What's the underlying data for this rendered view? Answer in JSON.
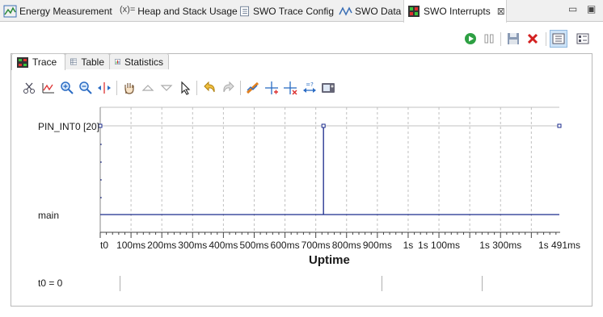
{
  "view_tabs": [
    {
      "label": "Energy Measurement",
      "icon": "energy-icon"
    },
    {
      "label": "Heap and Stack Usage",
      "icon": "heap-stack-icon"
    },
    {
      "label": "SWO Trace Config",
      "icon": "trace-config-icon"
    },
    {
      "label": "SWO Data",
      "icon": "swo-data-icon"
    },
    {
      "label": "SWO Interrupts",
      "icon": "swo-interrupts-icon",
      "active": true
    }
  ],
  "inner_tabs": [
    {
      "label": "Trace",
      "icon": "trace-icon",
      "active": true
    },
    {
      "label": "Table",
      "icon": "table-icon"
    },
    {
      "label": "Statistics",
      "icon": "statistics-icon"
    }
  ],
  "footer": {
    "t0_label": "t0 = 0"
  },
  "chart_data": {
    "type": "line",
    "xlabel": "Uptime",
    "ylabel": "",
    "x_tick_labels": [
      "t0",
      "100ms",
      "200ms",
      "300ms",
      "400ms",
      "500ms",
      "600ms",
      "700ms",
      "800ms",
      "900ms",
      "1s",
      "1s 100ms",
      "1s 300ms",
      "1s 491ms"
    ],
    "y_categories": [
      "PIN_INT0 [20]",
      "main"
    ],
    "xlim_ms": [
      0,
      1491
    ],
    "grid": true,
    "series": [
      {
        "name": "PIN_INT0 [20]",
        "pulses_ms": [
          0,
          725,
          1491
        ]
      }
    ],
    "colors": {
      "trace": "#1a2a8c",
      "grid": "#c0c0c0"
    }
  }
}
